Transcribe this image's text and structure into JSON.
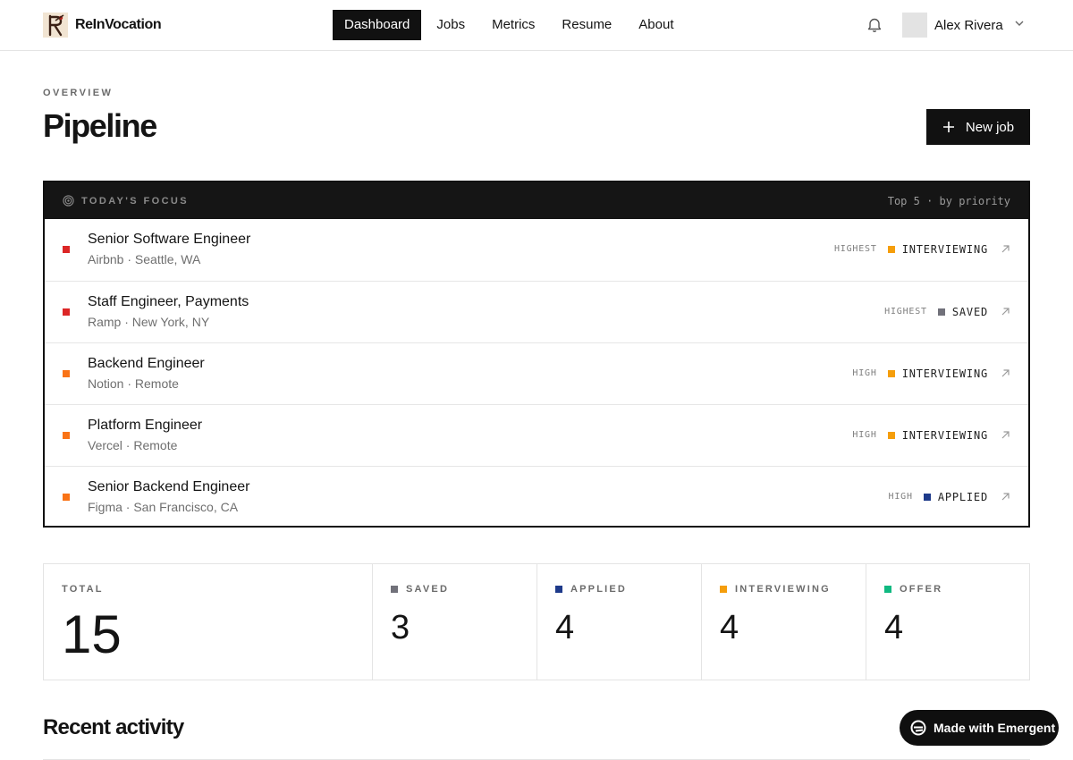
{
  "brand": {
    "name": "ReInVocation"
  },
  "nav": {
    "items": [
      {
        "label": "Dashboard",
        "active": true
      },
      {
        "label": "Jobs",
        "active": false
      },
      {
        "label": "Metrics",
        "active": false
      },
      {
        "label": "Resume",
        "active": false
      },
      {
        "label": "About",
        "active": false
      }
    ]
  },
  "user": {
    "name": "Alex Rivera",
    "icon": "chevron-down-icon"
  },
  "notifications": {
    "icon": "bell-icon"
  },
  "header": {
    "eyebrow": "OVERVIEW",
    "title": "Pipeline",
    "new_job_label": "New job",
    "new_job_icon": "plus-icon"
  },
  "focus": {
    "title": "TODAY'S FOCUS",
    "meta": "Top 5 · by priority",
    "icon": "target-icon",
    "jobs": [
      {
        "title": "Senior Software Engineer",
        "subtitle": "Airbnb · Seattle, WA",
        "priority": "HIGHEST",
        "priority_color": "#dc2626",
        "status": "INTERVIEWING",
        "status_color": "#f59e0b"
      },
      {
        "title": "Staff Engineer, Payments",
        "subtitle": "Ramp · New York, NY",
        "priority": "HIGHEST",
        "priority_color": "#dc2626",
        "status": "SAVED",
        "status_color": "#71717a"
      },
      {
        "title": "Backend Engineer",
        "subtitle": "Notion · Remote",
        "priority": "HIGH",
        "priority_color": "#f97316",
        "status": "INTERVIEWING",
        "status_color": "#f59e0b"
      },
      {
        "title": "Platform Engineer",
        "subtitle": "Vercel · Remote",
        "priority": "HIGH",
        "priority_color": "#f97316",
        "status": "INTERVIEWING",
        "status_color": "#f59e0b"
      },
      {
        "title": "Senior Backend Engineer",
        "subtitle": "Figma · San Francisco, CA",
        "priority": "HIGH",
        "priority_color": "#f97316",
        "status": "APPLIED",
        "status_color": "#1e3a8a"
      }
    ]
  },
  "stats": [
    {
      "label": "TOTAL",
      "value": "15",
      "color": ""
    },
    {
      "label": "SAVED",
      "value": "3",
      "color": "#71717a"
    },
    {
      "label": "APPLIED",
      "value": "4",
      "color": "#1e3a8a"
    },
    {
      "label": "INTERVIEWING",
      "value": "4",
      "color": "#f59e0b"
    },
    {
      "label": "OFFER",
      "value": "4",
      "color": "#10b981"
    }
  ],
  "recent": {
    "title": "Recent activity"
  },
  "badge": {
    "label": "Made with Emergent",
    "icon": "emergent-logo-icon"
  }
}
